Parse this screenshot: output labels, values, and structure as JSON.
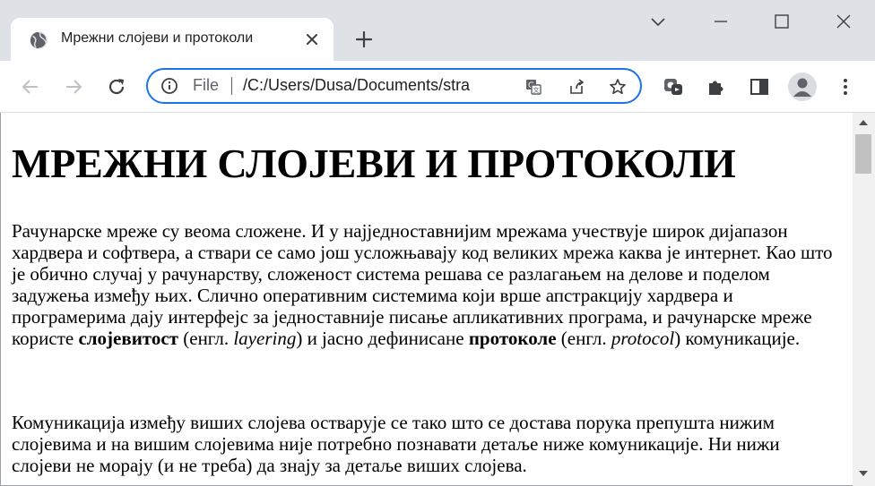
{
  "browser": {
    "tab_title": "Мрежни слојеви и протоколи",
    "address": {
      "scheme_label": "File",
      "url": "/C:/Users/Dusa/Documents/stra"
    }
  },
  "page": {
    "heading": "МРЕЖНИ СЛОЈЕВИ И ПРОТОКОЛИ",
    "p1": {
      "text_a": "Рачунарске мреже су веома сложене. И у најједноставнијим мрежама учествује широк дијапазон хардвера и софтвера, а ствари се само још усложњавају код великих мрежа каква је интернет. Као што је обично случај у рачунарству, сложеност система решава се разлагањем на делове и поделом задужења између њих. Слично оперативним системима који врше апстракцију хардвера и програмерима дају интерфејс за једноставније писање апликативних програма, и рачунарске мреже користе ",
      "term1": "слојевитост",
      "text_b": " (енгл. ",
      "en1": "layering",
      "text_c": ") и јасно дефинисане ",
      "term2": "протоколе",
      "text_d": " (енгл. ",
      "en2": "protocol",
      "text_e": ") комуникације."
    },
    "p2": "Комуникација између виших слојева остварује се тако што се достава порука препушта нижим слојевима и на вишим слојевима није потребно познавати детаље ниже комуникације. Ни нижи слојеви не морају (и не треба) да знају за детаље виших слојева."
  },
  "icons": {
    "tab_favicon": "globe-icon",
    "tab_close": "close-icon",
    "new_tab": "plus-icon",
    "back": "back-arrow-icon",
    "forward": "forward-arrow-icon",
    "reload": "reload-icon",
    "site_info": "info-icon",
    "translate": "translate-icon",
    "share": "share-icon",
    "bookmark": "star-icon",
    "extension_app": "extension-app-icon",
    "extensions": "puzzle-icon",
    "side_panel": "side-panel-icon",
    "profile": "profile-avatar-icon",
    "menu": "kebab-menu-icon"
  },
  "colors": {
    "tabstrip_bg": "#dee1e6",
    "omnibox_focus": "#1a73e8",
    "icon_gray": "#5f6368"
  }
}
